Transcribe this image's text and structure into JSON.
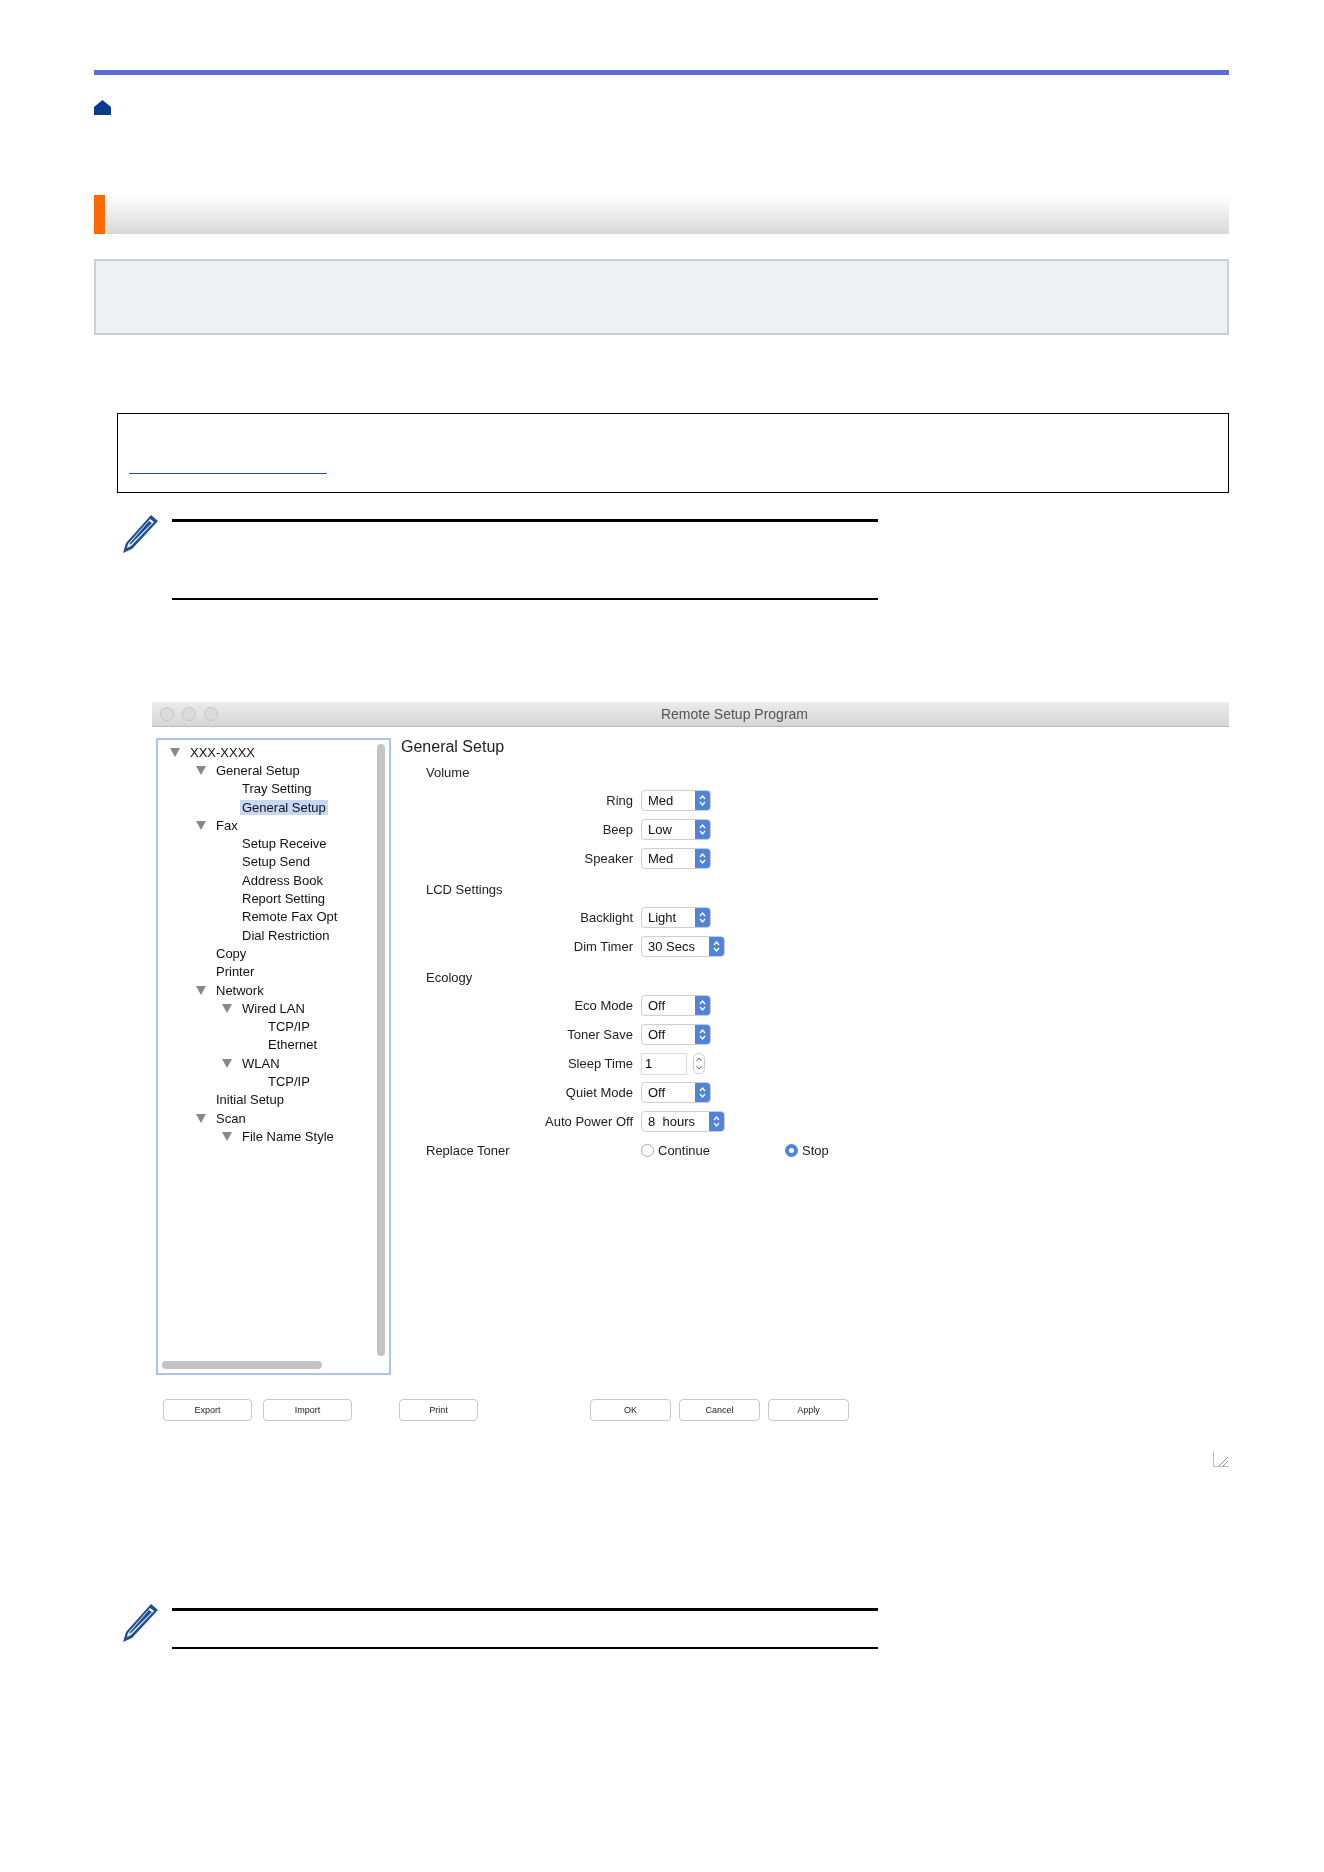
{
  "window": {
    "title": "Remote Setup Program"
  },
  "tree": [
    {
      "label": "XXX-XXXX",
      "expanded": true,
      "selected": false,
      "children": [
        {
          "label": "General Setup",
          "expanded": true,
          "selected": false,
          "children": [
            {
              "label": "Tray Setting",
              "selected": false
            },
            {
              "label": "General Setup",
              "selected": true
            }
          ]
        },
        {
          "label": "Fax",
          "expanded": true,
          "selected": false,
          "children": [
            {
              "label": "Setup Receive",
              "selected": false
            },
            {
              "label": "Setup Send",
              "selected": false
            },
            {
              "label": "Address Book",
              "selected": false
            },
            {
              "label": "Report Setting",
              "selected": false
            },
            {
              "label": "Remote Fax Opt",
              "selected": false
            },
            {
              "label": "Dial Restriction",
              "selected": false
            }
          ]
        },
        {
          "label": "Copy",
          "selected": false
        },
        {
          "label": "Printer",
          "selected": false
        },
        {
          "label": "Network",
          "expanded": true,
          "selected": false,
          "children": [
            {
              "label": "Wired LAN",
              "expanded": true,
              "selected": false,
              "children": [
                {
                  "label": "TCP/IP",
                  "selected": false
                },
                {
                  "label": "Ethernet",
                  "selected": false
                }
              ]
            },
            {
              "label": "WLAN",
              "expanded": true,
              "selected": false,
              "children": [
                {
                  "label": "TCP/IP",
                  "selected": false
                }
              ]
            }
          ]
        },
        {
          "label": "Initial Setup",
          "selected": false
        },
        {
          "label": "Scan",
          "expanded": true,
          "selected": false,
          "children": [
            {
              "label": "File Name Style",
              "expanded": true,
              "selected": false
            }
          ]
        }
      ]
    }
  ],
  "panel": {
    "title": "General Setup",
    "sections": [
      {
        "heading": "Volume",
        "rows": [
          {
            "kind": "select",
            "label": "Ring",
            "value": "Med"
          },
          {
            "kind": "select",
            "label": "Beep",
            "value": "Low"
          },
          {
            "kind": "select",
            "label": "Speaker",
            "value": "Med"
          }
        ]
      },
      {
        "heading": "LCD Settings",
        "rows": [
          {
            "kind": "select",
            "label": "Backlight",
            "value": "Light"
          },
          {
            "kind": "select",
            "label": "Dim Timer",
            "value": "30 Secs"
          }
        ]
      },
      {
        "heading": "Ecology",
        "rows": [
          {
            "kind": "select",
            "label": "Eco Mode",
            "value": "Off"
          },
          {
            "kind": "select",
            "label": "Toner Save",
            "value": "Off"
          },
          {
            "kind": "stepper",
            "label": "Sleep Time",
            "value": "1"
          },
          {
            "kind": "select",
            "label": "Quiet Mode",
            "value": "Off"
          },
          {
            "kind": "select",
            "label": "Auto Power Off",
            "value": "8  hours"
          }
        ]
      }
    ],
    "radio": {
      "label": "Replace Toner",
      "options": [
        {
          "label": "Continue",
          "selected": false
        },
        {
          "label": "Stop",
          "selected": true
        }
      ]
    }
  },
  "buttons": [
    {
      "label": "Export"
    },
    {
      "label": "Import"
    },
    {
      "label": "Print"
    },
    {
      "label": "OK"
    },
    {
      "label": "Cancel"
    },
    {
      "label": "Apply"
    }
  ]
}
